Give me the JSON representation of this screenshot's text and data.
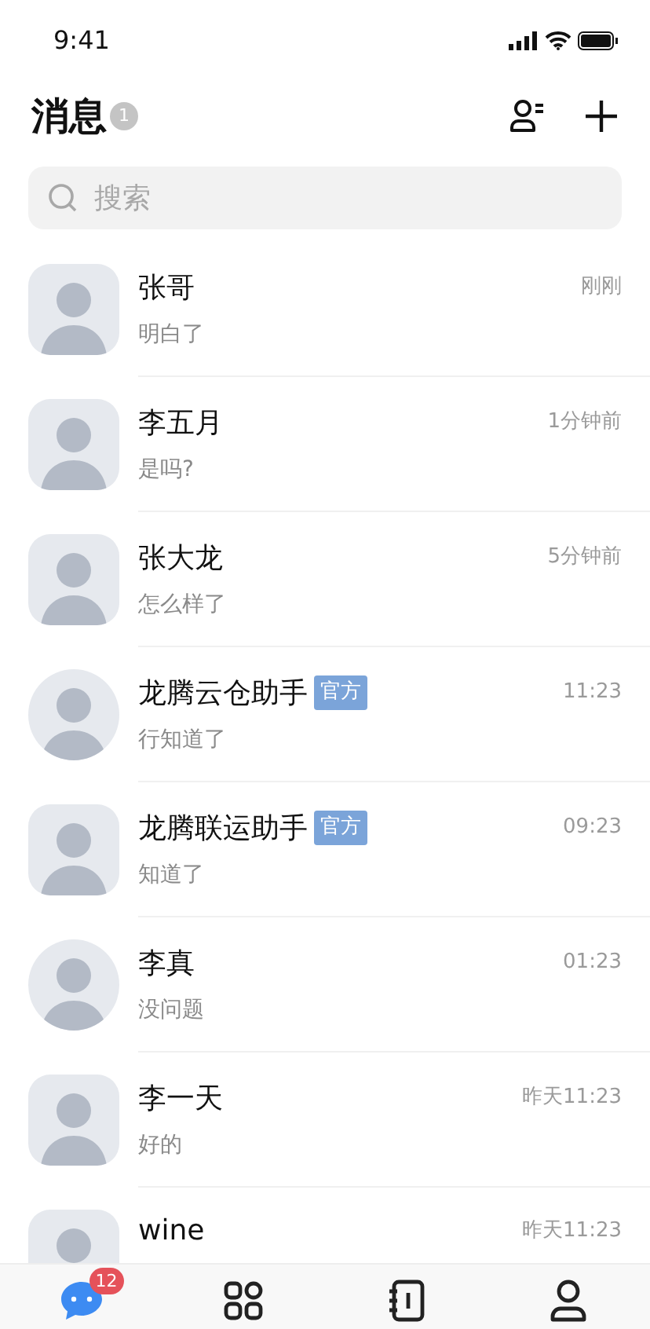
{
  "status_bar": {
    "time": "9:41"
  },
  "header": {
    "title": "消息",
    "badge": "1"
  },
  "search": {
    "placeholder": "搜索"
  },
  "conversations": [
    {
      "name": "张哥",
      "time": "刚刚",
      "preview": "明白了",
      "kind": "rounded"
    },
    {
      "name": "李五月",
      "time": "1分钟前",
      "preview": "是吗?",
      "kind": "rounded"
    },
    {
      "name": "张大龙",
      "time": "5分钟前",
      "preview": "怎么样了",
      "kind": "rounded"
    },
    {
      "name": "龙腾云仓助手",
      "tag": "官方",
      "time": "11:23",
      "preview": "行知道了",
      "kind": "circle"
    },
    {
      "name": "龙腾联运助手",
      "tag": "官方",
      "time": "09:23",
      "preview": "知道了",
      "kind": "rounded"
    },
    {
      "name": "李真",
      "time": "01:23",
      "preview": "没问题",
      "kind": "circle"
    },
    {
      "name": "李一天",
      "time": "昨天11:23",
      "preview": "好的",
      "kind": "rounded"
    },
    {
      "name": "wine",
      "time": "昨天11:23",
      "kind": "rounded"
    }
  ],
  "tab_bar": [
    {
      "kind": "chat",
      "selected": true,
      "badge": "12"
    },
    {
      "kind": "grid",
      "selected": false
    },
    {
      "kind": "contacts",
      "selected": false
    },
    {
      "kind": "person",
      "selected": false
    }
  ]
}
